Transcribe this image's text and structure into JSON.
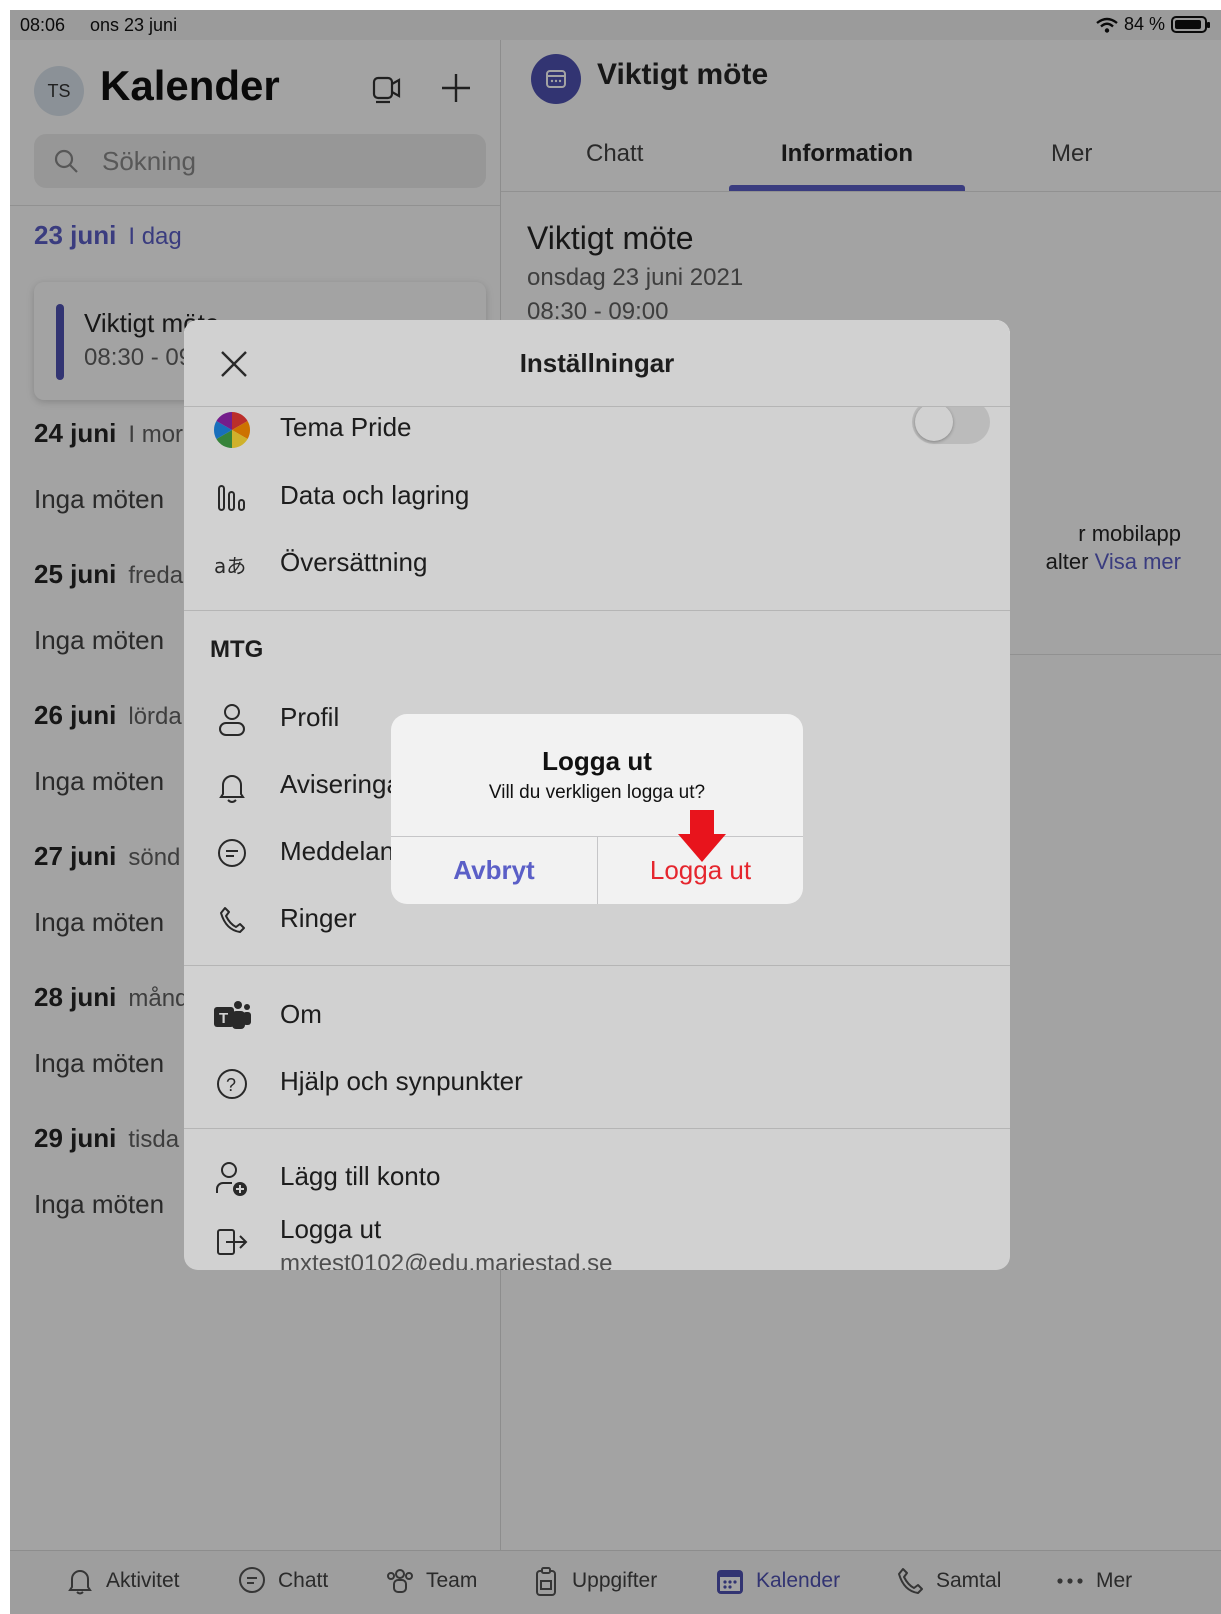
{
  "status": {
    "time": "08:06",
    "date": "ons 23 juni",
    "battery": "84 %"
  },
  "left": {
    "avatar": "TS",
    "title": "Kalender",
    "search_placeholder": "Sökning",
    "days": [
      {
        "date": "23 juni",
        "sub": "I dag"
      },
      {
        "date": "24 juni",
        "sub": "I mor"
      },
      {
        "date": "25 juni",
        "sub": "freda"
      },
      {
        "date": "26 juni",
        "sub": "lörda"
      },
      {
        "date": "27 juni",
        "sub": "sönd"
      },
      {
        "date": "28 juni",
        "sub": "månd"
      },
      {
        "date": "29 juni",
        "sub": "tisda"
      }
    ],
    "event": {
      "title": "Viktigt möte",
      "time": "08:30 - 09:"
    },
    "no_meetings": "Inga möten"
  },
  "right": {
    "title": "Viktigt möte",
    "tabs": [
      "Chatt",
      "Information",
      "Mer"
    ],
    "active_tab": "Information",
    "meeting_title": "Viktigt möte",
    "meeting_date": "onsdag 23 juni 2021",
    "meeting_time": "08:30 - 09:00",
    "desc_line1": "r mobilapp",
    "desc_line2": "alter",
    "show_more": "Visa mer"
  },
  "settings": {
    "title": "Inställningar",
    "items_top": [
      {
        "label": "Tema Pride",
        "icon": "pride-theme-icon"
      },
      {
        "label": "Data och lagring",
        "icon": "data-storage-icon"
      },
      {
        "label": "Översättning",
        "icon": "translation-icon"
      }
    ],
    "section": "MTG",
    "items_mtg": [
      {
        "label": "Profil",
        "icon": "profile-icon"
      },
      {
        "label": "Aviseringar",
        "icon": "bell-icon"
      },
      {
        "label": "Meddelanden",
        "icon": "message-icon"
      },
      {
        "label": "Ringer",
        "icon": "phone-icon"
      }
    ],
    "items_about": [
      {
        "label": "Om",
        "icon": "teams-logo-icon"
      },
      {
        "label": "Hjälp och synpunkter",
        "icon": "help-icon"
      }
    ],
    "add_account": "Lägg till konto",
    "logout": "Logga ut",
    "email": "mxtest0102@edu.mariestad.se",
    "pride_toggle_on": false
  },
  "alert": {
    "title": "Logga ut",
    "message": "Vill du verkligen logga ut?",
    "cancel": "Avbryt",
    "confirm": "Logga ut"
  },
  "tabbar": [
    {
      "label": "Aktivitet",
      "icon": "bell-icon"
    },
    {
      "label": "Chatt",
      "icon": "chat-icon"
    },
    {
      "label": "Team",
      "icon": "team-icon"
    },
    {
      "label": "Uppgifter",
      "icon": "tasks-icon"
    },
    {
      "label": "Kalender",
      "icon": "calendar-icon"
    },
    {
      "label": "Samtal",
      "icon": "phone-icon"
    },
    {
      "label": "Mer",
      "icon": "more-icon"
    }
  ],
  "colors": {
    "accent": "#5b5fc7",
    "danger": "#e5262e",
    "arrow": "#e8141c"
  }
}
